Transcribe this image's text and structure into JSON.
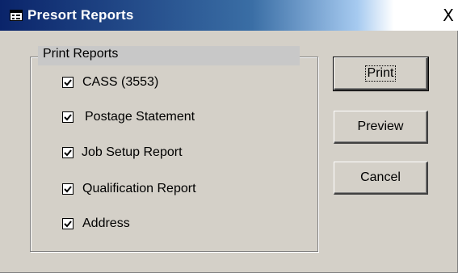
{
  "window": {
    "title": "Presort Reports",
    "close_glyph": "X",
    "icon": "form-icon"
  },
  "group": {
    "label": "Print Reports",
    "items": [
      {
        "label": "CASS (3553)",
        "checked": true
      },
      {
        "label": "Postage Statement",
        "checked": true
      },
      {
        "label": "Job Setup Report",
        "checked": true
      },
      {
        "label": "Qualification Report",
        "checked": true
      },
      {
        "label": "Address",
        "checked": true
      }
    ]
  },
  "buttons": {
    "print": "Print",
    "preview": "Preview",
    "cancel": "Cancel"
  },
  "colors": {
    "title_start": "#0a246a",
    "title_end": "#a6caf0",
    "face": "#d4d0c8"
  }
}
